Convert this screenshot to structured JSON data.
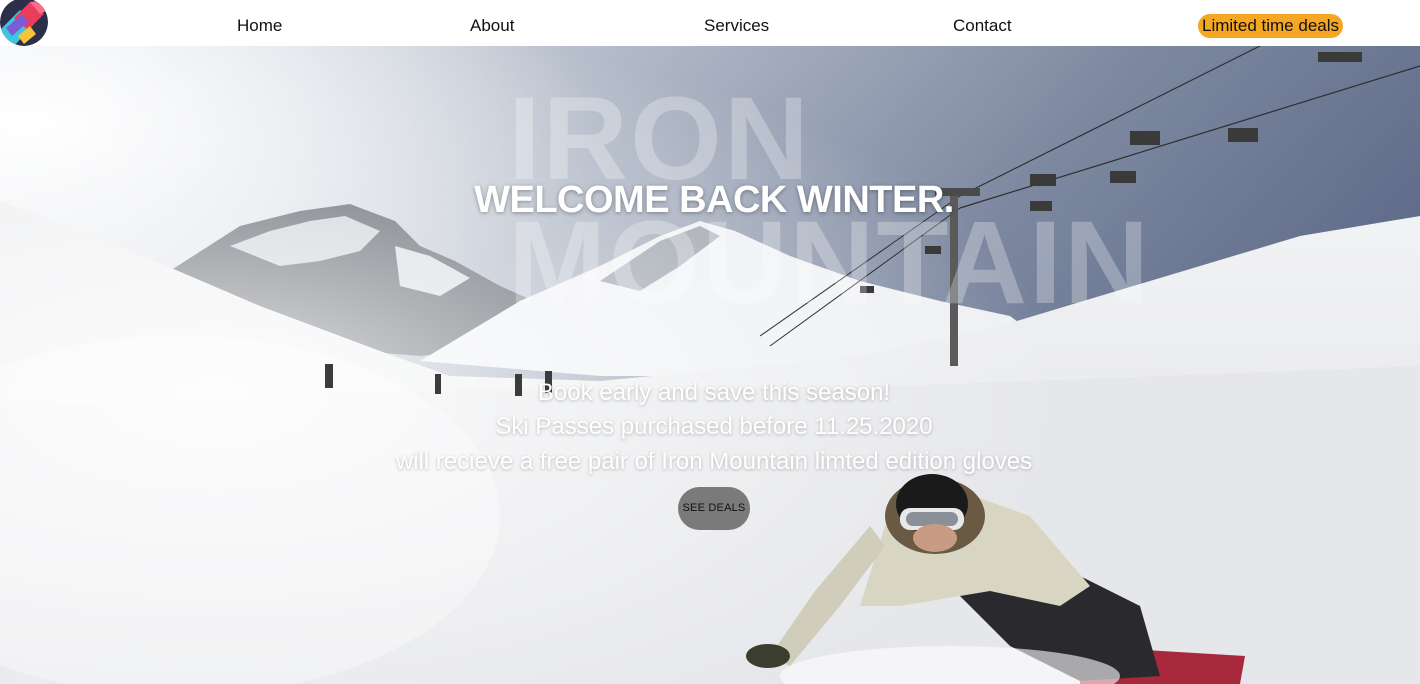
{
  "nav": {
    "home": "Home",
    "about": "About",
    "services": "Services",
    "contact": "Contact",
    "deals": "Limited time deals",
    "logo_icon": "multicolor-logo-icon",
    "deals_highlight_color": "#f5a623"
  },
  "hero": {
    "watermark_line1": "IRON",
    "watermark_line2": "MOUNTAIN",
    "headline": "WELCOME BACK WINTER.",
    "promo_line1": "Book early and save this season!",
    "promo_line2": "Ski Passes purchased before 11.25.2020",
    "promo_line3": "will recieve a free pair of Iron Mountain limted edition gloves",
    "cta_label": "SEE DEALS",
    "cta_color": "#7a7a7a",
    "background": "snowboarder-ski-slope-photo"
  }
}
